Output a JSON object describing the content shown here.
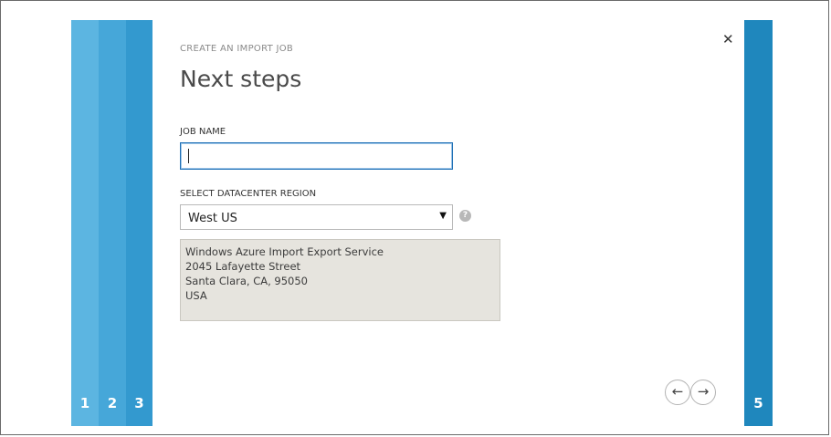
{
  "steps": {
    "left": [
      "1",
      "2",
      "3"
    ],
    "right": "5"
  },
  "dialog": {
    "eyebrow": "CREATE AN IMPORT JOB",
    "title": "Next steps",
    "job_name_label": "JOB NAME",
    "job_name_value": "",
    "region_label": "SELECT DATACENTER REGION",
    "region_selected": "West US",
    "address_lines": [
      "Windows Azure Import Export Service",
      "2045 Lafayette Street",
      "Santa Clara, CA, 95050",
      "USA"
    ]
  },
  "icons": {
    "close": "close-icon",
    "help": "help-icon",
    "prev": "arrow-left-icon",
    "next": "arrow-right-icon",
    "dropdown": "caret-down-icon"
  },
  "colors": {
    "step1": "#5cb5e1",
    "step2": "#46a7d9",
    "step3": "#3399cf",
    "step5": "#1f87bd",
    "address_bg": "#e6e4de",
    "input_focus": "#1e6fb5"
  }
}
